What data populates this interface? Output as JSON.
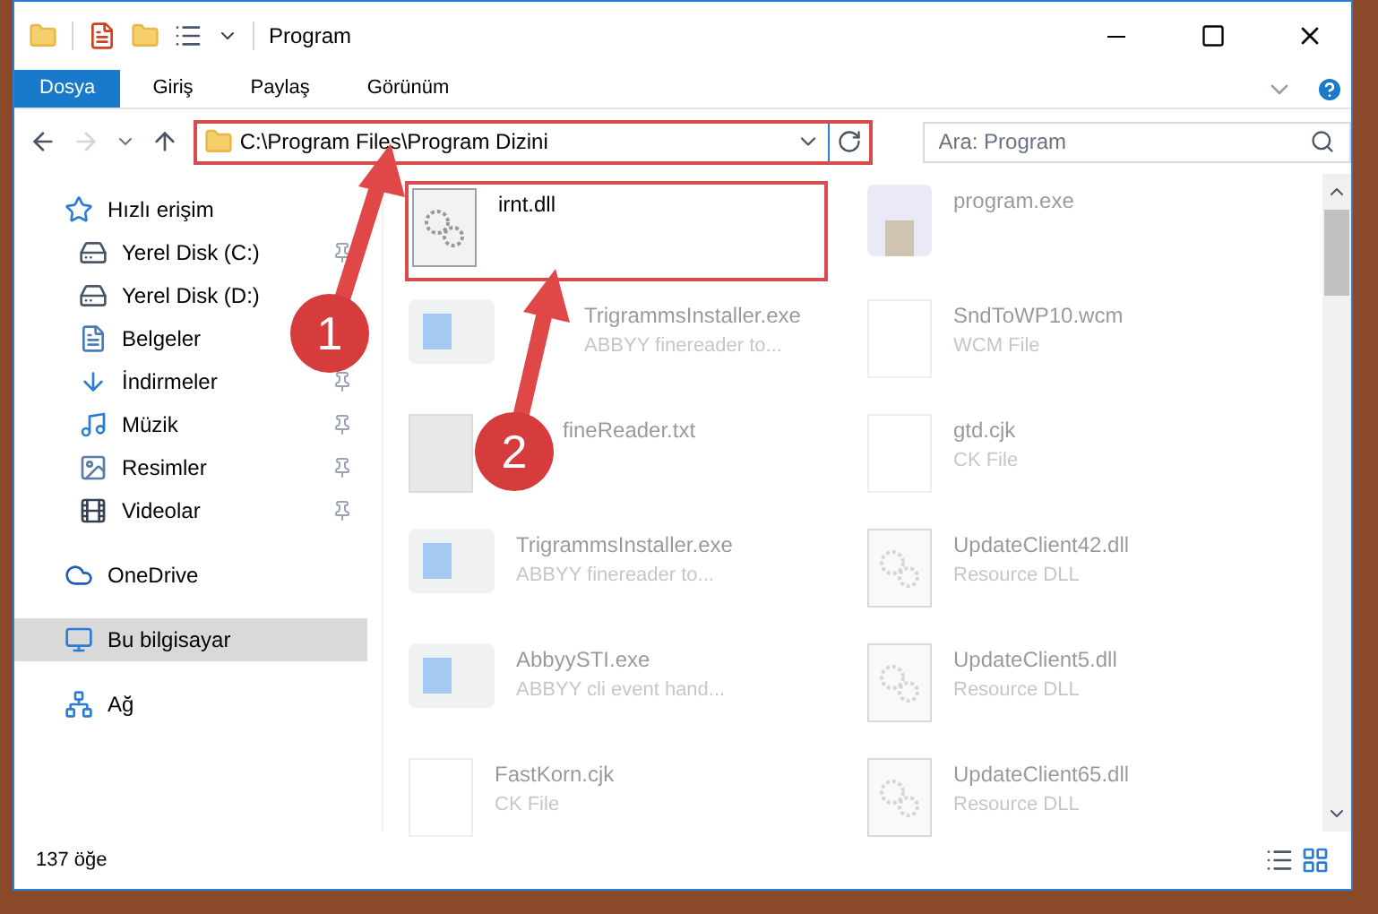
{
  "window": {
    "title": "Program"
  },
  "ribbon_tabs": [
    {
      "label": "Dosya",
      "selected": true
    },
    {
      "label": "Giriş",
      "selected": false
    },
    {
      "label": "Paylaş",
      "selected": false
    },
    {
      "label": "Görünüm",
      "selected": false
    }
  ],
  "address": {
    "path": "C:\\Program Files\\Program Dizini"
  },
  "search": {
    "placeholder": "Ara: Program"
  },
  "sidebar": {
    "items": [
      {
        "label": "Hızlı erişim",
        "kind": "quick",
        "pinned": false,
        "selected": false,
        "children": [
          {
            "label": "Yerel Disk (C:)",
            "kind": "diskc",
            "pinned": true,
            "selected": false
          },
          {
            "label": "Yerel Disk (D:)",
            "kind": "disk",
            "pinned": false,
            "selected": false
          },
          {
            "label": "Belgeler",
            "kind": "docs",
            "pinned": false,
            "selected": false
          },
          {
            "label": "İndirmeler",
            "kind": "download",
            "pinned": true,
            "selected": false
          },
          {
            "label": "Müzik",
            "kind": "music",
            "pinned": true,
            "selected": false
          },
          {
            "label": "Resimler",
            "kind": "pictures",
            "pinned": true,
            "selected": false
          },
          {
            "label": "Videolar",
            "kind": "videos",
            "pinned": true,
            "selected": false
          }
        ]
      },
      {
        "label": "OneDrive",
        "kind": "cloud",
        "pinned": false,
        "selected": false
      },
      {
        "label": "Bu bilgisayar",
        "kind": "pc",
        "pinned": false,
        "selected": true
      },
      {
        "label": "Ağ",
        "kind": "network",
        "pinned": false,
        "selected": false
      }
    ]
  },
  "files": [
    {
      "name": "irnt.dll",
      "kind": "dll",
      "highlighted": true
    },
    {
      "name": "program.exe",
      "kind": "app",
      "highlighted": false
    },
    {
      "name": "TrigrammsInstaller.exe",
      "detail": "ABBYY finereader to...",
      "kind": "installer",
      "highlighted": false
    },
    {
      "name": "SndToWP10.wcm",
      "detail": "WCM File",
      "kind": "file",
      "highlighted": false
    },
    {
      "name": "fineReader.txt",
      "kind": "blank",
      "highlighted": false
    },
    {
      "name": "gtd.cjk",
      "detail": "CK File",
      "kind": "file",
      "highlighted": false
    },
    {
      "name": "TrigrammsInstaller.exe",
      "detail": "ABBYY finereader to...",
      "kind": "installer",
      "highlighted": false
    },
    {
      "name": "UpdateClient42.dll",
      "detail": "Resource DLL",
      "kind": "dll",
      "highlighted": false
    },
    {
      "name": "AbbyySTI.exe",
      "detail": "ABBYY cli event hand...",
      "kind": "installer",
      "highlighted": false
    },
    {
      "name": "UpdateClient5.dll",
      "detail": "Resource DLL",
      "kind": "dll",
      "highlighted": false
    },
    {
      "name": "FastKorn.cjk",
      "detail": "CK File",
      "kind": "file",
      "highlighted": false
    },
    {
      "name": "UpdateClient65.dll",
      "detail": "Resource DLL",
      "kind": "dll",
      "highlighted": false
    }
  ],
  "status_bar": {
    "count": "137 öğe"
  },
  "annotations": [
    {
      "label": "1"
    },
    {
      "label": "2"
    }
  ]
}
